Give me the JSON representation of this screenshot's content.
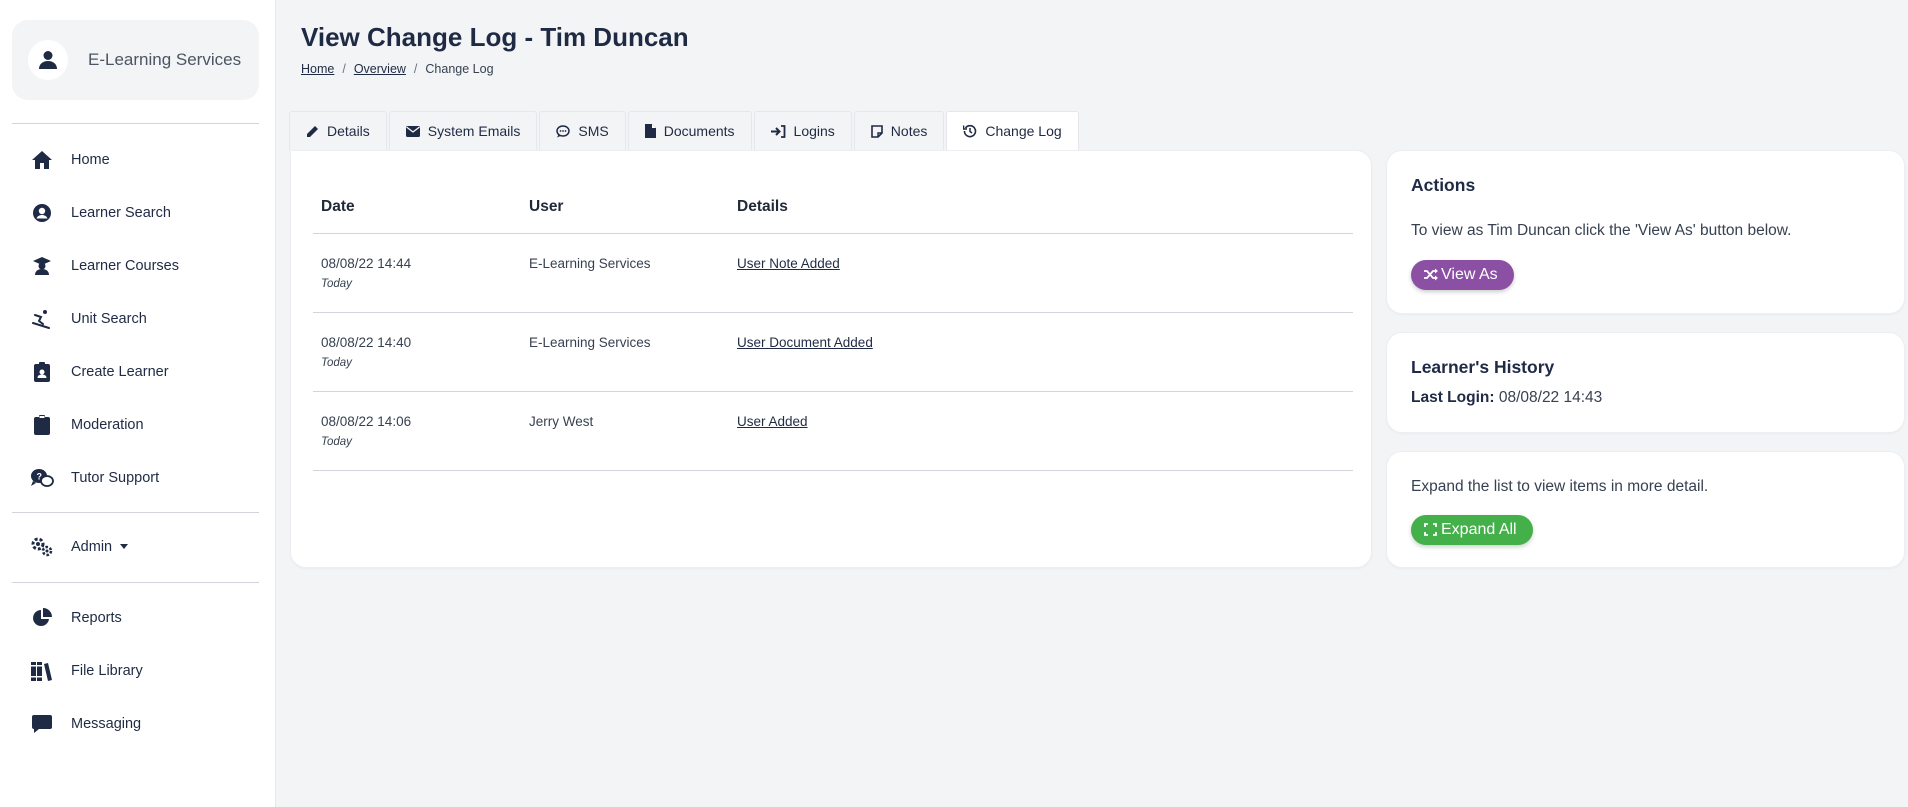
{
  "sidebar": {
    "org_name": "E-Learning Services",
    "nav_primary": [
      {
        "label": "Home",
        "icon": "home-icon"
      },
      {
        "label": "Learner Search",
        "icon": "user-circle-icon"
      },
      {
        "label": "Learner Courses",
        "icon": "graduate-icon"
      },
      {
        "label": "Unit Search",
        "icon": "skier-icon"
      },
      {
        "label": "Create Learner",
        "icon": "clipboard-user-icon"
      },
      {
        "label": "Moderation",
        "icon": "clipboard-icon"
      },
      {
        "label": "Tutor Support",
        "icon": "comments-question-icon"
      }
    ],
    "admin_label": "Admin",
    "nav_secondary": [
      {
        "label": "Reports",
        "icon": "pie-chart-icon"
      },
      {
        "label": "File Library",
        "icon": "books-icon"
      },
      {
        "label": "Messaging",
        "icon": "message-icon"
      }
    ]
  },
  "header": {
    "title": "View Change Log - Tim Duncan",
    "breadcrumb": {
      "home": "Home",
      "overview": "Overview",
      "current": "Change Log",
      "separator": "/"
    }
  },
  "tabs": [
    {
      "label": "Details",
      "icon": "pencil-icon"
    },
    {
      "label": "System Emails",
      "icon": "envelope-icon"
    },
    {
      "label": "SMS",
      "icon": "sms-icon"
    },
    {
      "label": "Documents",
      "icon": "file-icon"
    },
    {
      "label": "Logins",
      "icon": "sign-in-icon"
    },
    {
      "label": "Notes",
      "icon": "note-icon"
    },
    {
      "label": "Change Log",
      "icon": "history-icon",
      "active": true
    }
  ],
  "change_log": {
    "columns": [
      "Date",
      "User",
      "Details"
    ],
    "rows": [
      {
        "date": "08/08/22 14:44",
        "relative": "Today",
        "user": "E-Learning Services",
        "details": "User Note Added"
      },
      {
        "date": "08/08/22 14:40",
        "relative": "Today",
        "user": "E-Learning Services",
        "details": "User Document Added"
      },
      {
        "date": "08/08/22 14:06",
        "relative": "Today",
        "user": "Jerry West",
        "details": "User Added"
      }
    ]
  },
  "actions": {
    "title": "Actions",
    "text": "To view as Tim Duncan click the 'View As' button below.",
    "button": "View As"
  },
  "history": {
    "title": "Learner's History",
    "last_login_label": "Last Login:",
    "last_login_value": "08/08/22 14:43"
  },
  "expand": {
    "text": "Expand the list to view items in more detail.",
    "button": "Expand All"
  },
  "colors": {
    "primary_text": "#1f2a44",
    "view_as": "#8b4fa3",
    "expand_all": "#43b04a",
    "background": "#f3f4f6"
  }
}
